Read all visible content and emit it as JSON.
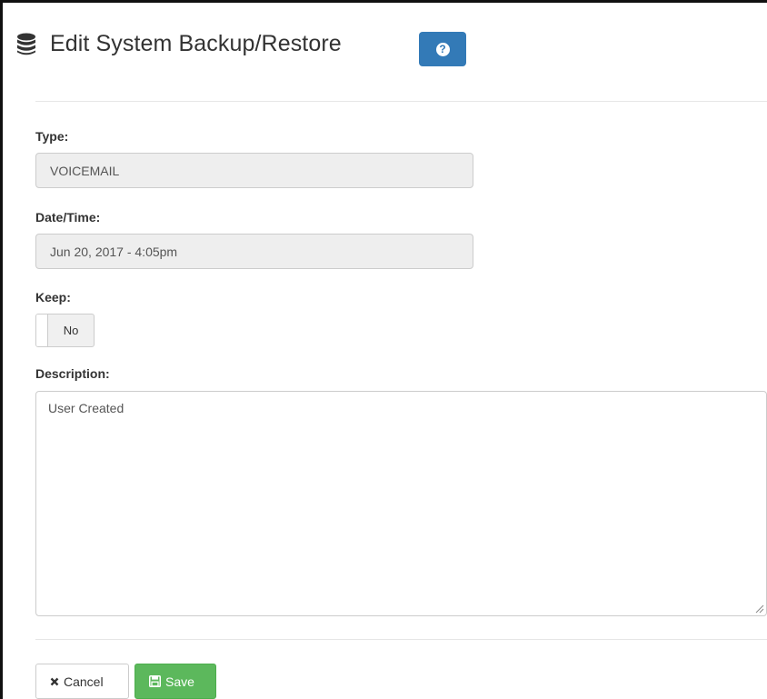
{
  "header": {
    "title": "Edit System Backup/Restore",
    "title_icon": "database-icon",
    "help_icon": "question-circle-icon",
    "help_symbol": "?"
  },
  "form": {
    "type": {
      "label": "Type:",
      "value": "VOICEMAIL"
    },
    "datetime": {
      "label": "Date/Time:",
      "value": "Jun 20, 2017 -  4:05pm"
    },
    "keep": {
      "label": "Keep:",
      "value": "No"
    },
    "description": {
      "label": "Description:",
      "value": "User Created"
    }
  },
  "actions": {
    "cancel_label": "Cancel",
    "cancel_icon": "times-icon",
    "save_label": "Save",
    "save_icon": "floppy-disk-icon"
  },
  "colors": {
    "primary": "#337ab7",
    "success": "#5cb85c",
    "readonly_bg": "#eeeeee"
  }
}
